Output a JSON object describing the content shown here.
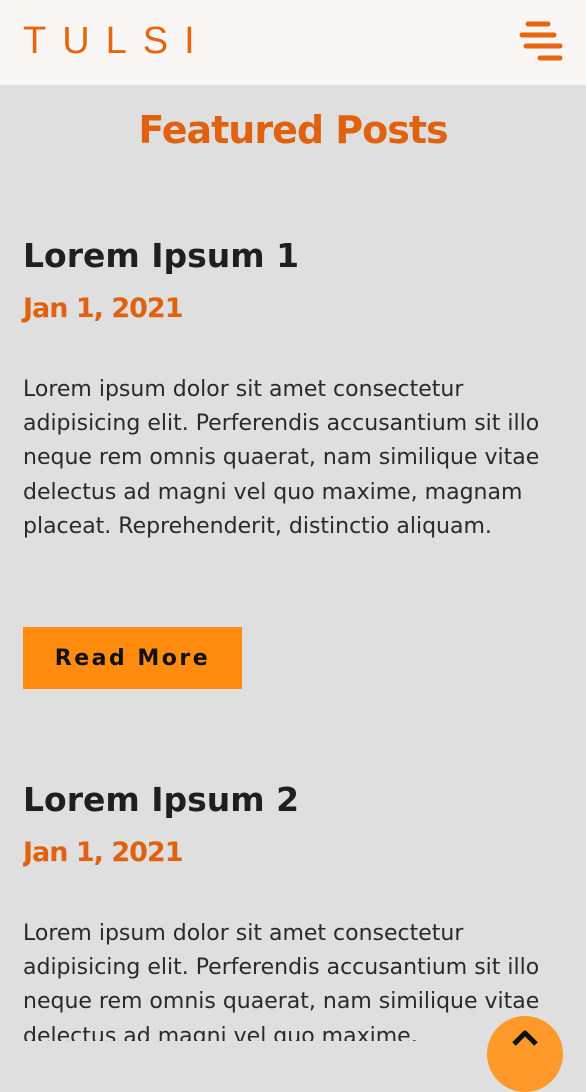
{
  "header": {
    "logo": "TULSI",
    "menu_icon": "hamburger-menu-icon"
  },
  "section": {
    "title": "Featured Posts"
  },
  "posts": [
    {
      "title": "Lorem Ipsum 1",
      "date": "Jan 1, 2021",
      "body": "Lorem ipsum dolor sit amet consectetur adipisicing elit. Perferendis accusantium sit illo neque rem omnis quaerat, nam similique vitae delectus ad magni vel quo maxime, magnam placeat. Reprehenderit, distinctio aliquam.",
      "button_label": "Read More"
    },
    {
      "title": "Lorem Ipsum 2",
      "date": "Jan 1, 2021",
      "body": "Lorem ipsum dolor sit amet consectetur adipisicing elit. Perferendis accusantium sit illo neque rem omnis quaerat, nam similique vitae delectus ad magni vel quo maxime,"
    }
  ],
  "scroll_top_icon": "chevron-up-icon",
  "colors": {
    "accent": "#e1620e",
    "button": "#ff8c0f",
    "background": "#dfdfdf",
    "header": "#f8f7f6"
  }
}
